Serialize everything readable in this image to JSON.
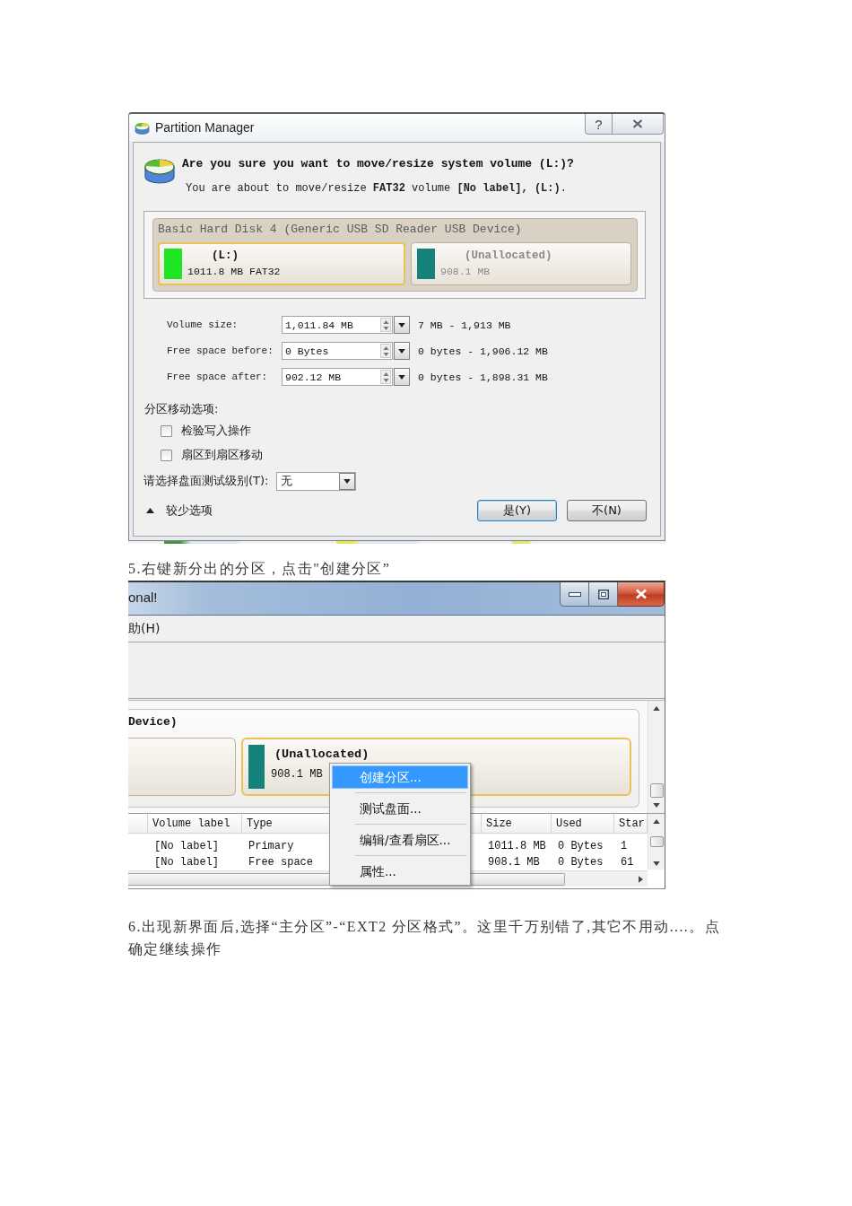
{
  "dialog": {
    "title": "Partition Manager",
    "help_button": "?",
    "question": "Are you sure you want to move/resize system volume (L:)?",
    "detail": "You are about to move/resize **FAT32** volume **[No label], (L:)**.",
    "disk": {
      "title": "Basic Hard Disk 4 (Generic USB SD Reader USB Device)",
      "partitions": [
        {
          "name": "(L:)",
          "size": "1011.8 MB FAT32",
          "color": "#1ee624",
          "selected": true
        },
        {
          "name": "(Unallocated)",
          "size": "908.1 MB",
          "color": "#14827a",
          "selected": false
        }
      ]
    },
    "fields": [
      {
        "label": "Volume size:",
        "value": "1,011.84 MB",
        "range": "7 MB - 1,913 MB"
      },
      {
        "label": "Free space before:",
        "value": "0 Bytes",
        "range": "0 bytes - 1,906.12 MB"
      },
      {
        "label": "Free space after:",
        "value": "902.12 MB",
        "range": "0 bytes - 1,898.31 MB"
      }
    ],
    "move_options": {
      "title": "分区移动选项:",
      "checkboxes": [
        {
          "label": "检验写入操作",
          "checked": false
        },
        {
          "label": "扇区到扇区移动",
          "checked": false
        }
      ]
    },
    "test_level": {
      "label": "请选择盘面测试级别(T):",
      "value": "无"
    },
    "toggle": {
      "label": "较少选项",
      "expanded": true
    },
    "buttons": [
      {
        "label": "是(Y)",
        "default": true
      },
      {
        "label": "不(N)",
        "default": false
      }
    ]
  },
  "caption_step5": "5.右键新分出的分区，点击\"创建分区”",
  "app_window": {
    "title": "onal!",
    "menu": [
      "助(H)"
    ],
    "disk_title": "Device)",
    "partitions": [
      {
        "selected": false
      },
      {
        "name": "(Unallocated)",
        "size": "908.1 MB",
        "color": "#14827a",
        "selected": true
      }
    ],
    "table": {
      "columns": [
        "Volume label",
        "Type",
        "Size",
        "Used",
        "Star"
      ],
      "rows": [
        [
          "[No label]",
          "Primary",
          "1011.8 MB",
          "0 Bytes",
          "1"
        ],
        [
          "[No label]",
          "Free space",
          "908.1 MB",
          "0 Bytes",
          "61"
        ]
      ]
    },
    "context_menu": [
      {
        "label": "创建分区...",
        "selected": true
      },
      {
        "label": "测试盘面...",
        "selected": false
      },
      {
        "label": "编辑/查看扇区...",
        "selected": false
      },
      {
        "label": "属性...",
        "selected": false
      }
    ]
  },
  "caption_step6": "6.出现新界面后,选择“主分区”-“EXT2 分区格式”。这里千万别错了,其它不用动....。点确定继续操作"
}
